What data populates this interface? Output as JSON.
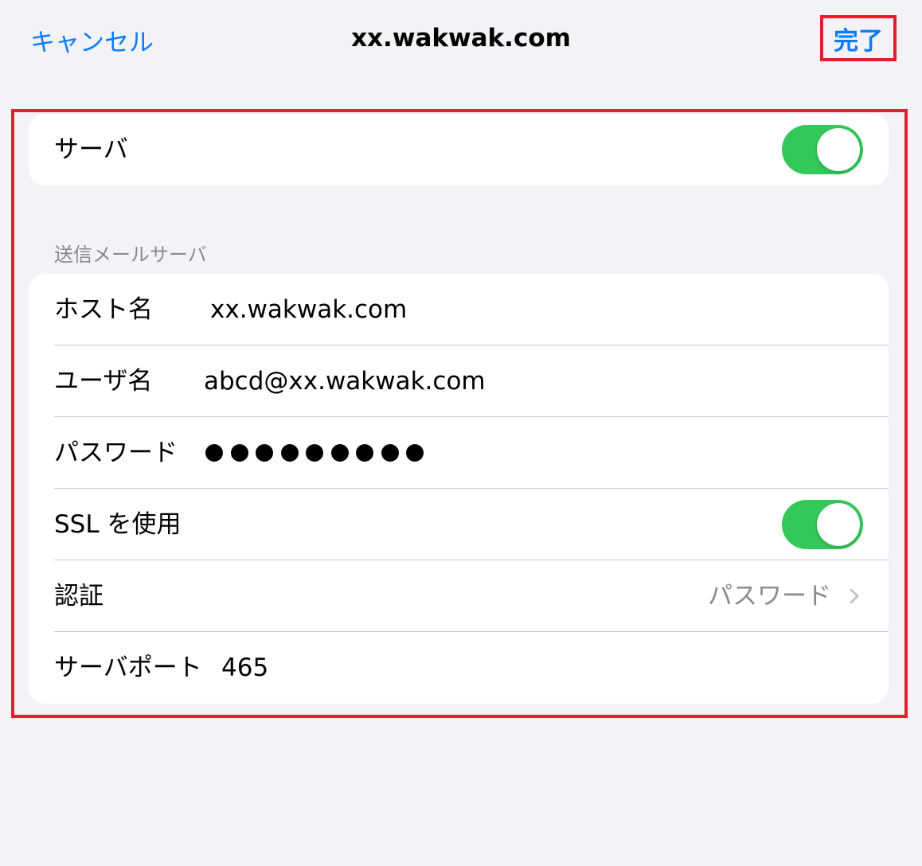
{
  "nav": {
    "cancel": "キャンセル",
    "title": "xx.wakwak.com",
    "done": "完了"
  },
  "server_row": {
    "label": "サーバ",
    "toggle_on": true
  },
  "smtp_section": {
    "header": "送信メールサーバ",
    "host": {
      "label": "ホスト名",
      "value": "xx.wakwak.com"
    },
    "user": {
      "label": "ユーザ名",
      "value": "abcd@xx.wakwak.com"
    },
    "password": {
      "label": "パスワード",
      "masked_length": 9
    },
    "ssl": {
      "label": "SSL を使用",
      "toggle_on": true
    },
    "auth": {
      "label": "認証",
      "value": "パスワード"
    },
    "port": {
      "label": "サーバポート",
      "value": "465"
    }
  },
  "colors": {
    "accent": "#0a7aff",
    "toggle_on": "#34c759",
    "highlight": "#e0202b",
    "background": "#f2f2f7"
  },
  "icons": {
    "chevron": "chevron-right-icon",
    "password_dot": "bullet-dot-icon"
  }
}
